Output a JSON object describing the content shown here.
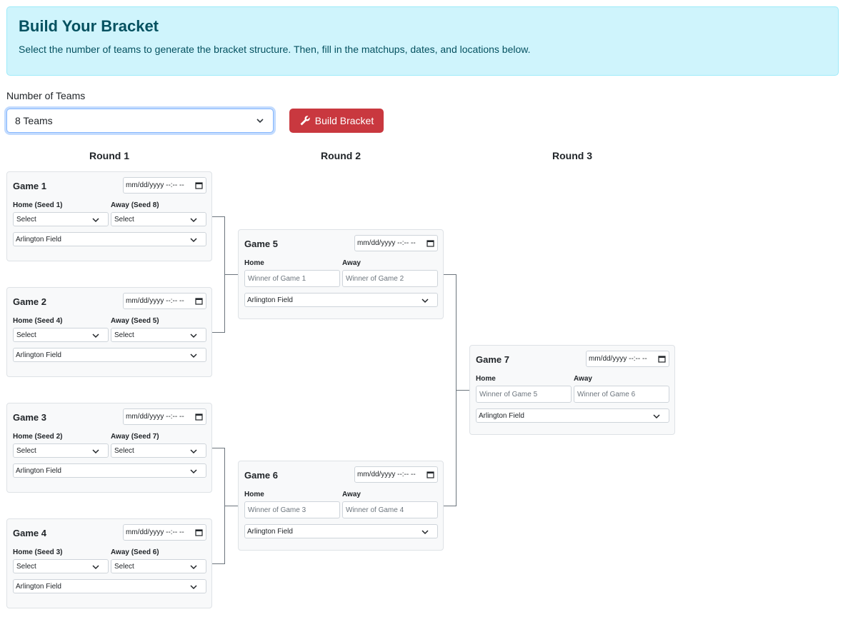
{
  "header": {
    "title": "Build Your Bracket",
    "description": "Select the number of teams to generate the bracket structure. Then, fill in the matchups, dates, and locations below."
  },
  "controls": {
    "num_teams_label": "Number of Teams",
    "num_teams_value": "8 Teams",
    "build_button_label": "Build Bracket"
  },
  "rounds": [
    "Round 1",
    "Round 2",
    "Round 3"
  ],
  "date_placeholder": "mm/dd/yyyy --:-- --",
  "games": [
    {
      "title": "Game 1",
      "home_label": "Home (Seed 1)",
      "away_label": "Away (Seed 8)",
      "home": "Select",
      "away": "Select",
      "location": "Arlington Field"
    },
    {
      "title": "Game 2",
      "home_label": "Home (Seed 4)",
      "away_label": "Away (Seed 5)",
      "home": "Select",
      "away": "Select",
      "location": "Arlington Field"
    },
    {
      "title": "Game 3",
      "home_label": "Home (Seed 2)",
      "away_label": "Away (Seed 7)",
      "home": "Select",
      "away": "Select",
      "location": "Arlington Field"
    },
    {
      "title": "Game 4",
      "home_label": "Home (Seed 3)",
      "away_label": "Away (Seed 6)",
      "home": "Select",
      "away": "Select",
      "location": "Arlington Field"
    },
    {
      "title": "Game 5",
      "home_label": "Home",
      "away_label": "Away",
      "home": "Winner of Game 1",
      "away": "Winner of Game 2",
      "location": "Arlington Field"
    },
    {
      "title": "Game 6",
      "home_label": "Home",
      "away_label": "Away",
      "home": "Winner of Game 3",
      "away": "Winner of Game 4",
      "location": "Arlington Field"
    },
    {
      "title": "Game 7",
      "home_label": "Home",
      "away_label": "Away",
      "home": "Winner of Game 5",
      "away": "Winner of Game 6",
      "location": "Arlington Field"
    }
  ],
  "colors": {
    "alert_bg": "#cff4fc",
    "alert_text": "#055160",
    "build_button_bg": "#c9383f",
    "card_bg": "#f8f9fa",
    "connector": "#6c757d"
  }
}
